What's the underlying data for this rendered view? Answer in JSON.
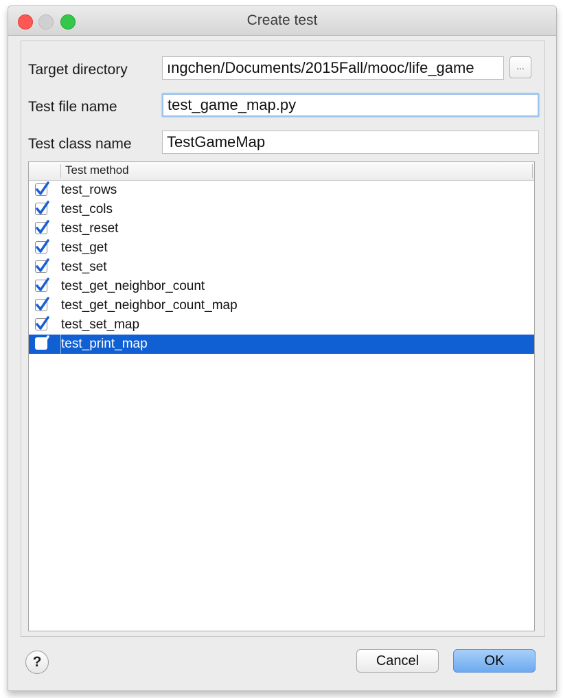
{
  "window": {
    "title": "Create test"
  },
  "form": {
    "target_directory_label": "Target directory",
    "target_directory_value": "ıngchen/Documents/2015Fall/mooc/life_game",
    "browse_label": "...",
    "test_file_label": "Test file name",
    "test_file_value": "test_game_map.py",
    "test_class_label": "Test class name",
    "test_class_value": "TestGameMap"
  },
  "table": {
    "header": "Test method",
    "rows": [
      {
        "name": "test_rows",
        "checked": true
      },
      {
        "name": "test_cols",
        "checked": true
      },
      {
        "name": "test_reset",
        "checked": true
      },
      {
        "name": "test_get",
        "checked": true
      },
      {
        "name": "test_set",
        "checked": true
      },
      {
        "name": "test_get_neighbor_count",
        "checked": true
      },
      {
        "name": "test_get_neighbor_count_map",
        "checked": true
      },
      {
        "name": "test_set_map",
        "checked": true
      },
      {
        "name": "test_print_map",
        "checked": true,
        "selected": true
      }
    ]
  },
  "footer": {
    "help": "?",
    "cancel": "Cancel",
    "ok": "OK"
  },
  "colors": {
    "selection": "#1160d3",
    "check": "#1a5fd6",
    "close": "#fc5753",
    "maximize": "#34c84a"
  },
  "icons": {
    "check": "check-icon",
    "help": "help-icon",
    "browse": "ellipsis-icon"
  }
}
